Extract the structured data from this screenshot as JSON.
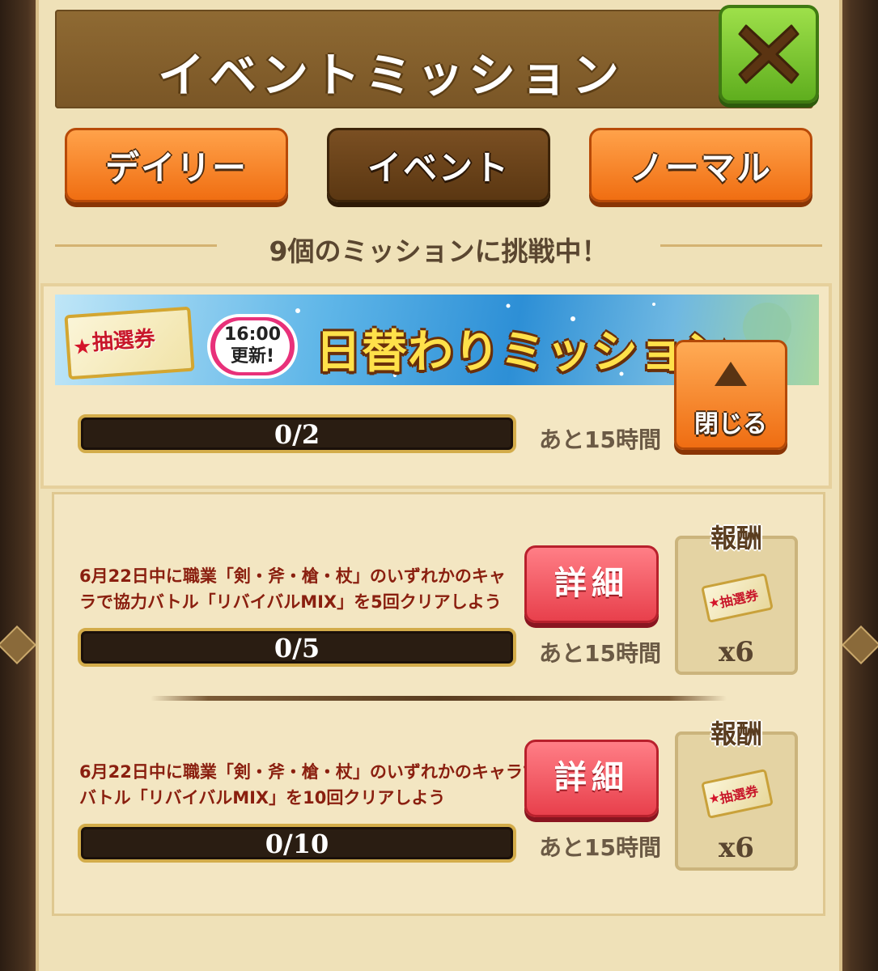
{
  "header": {
    "title": "イベントミッション",
    "close_icon": "close-icon"
  },
  "tabs": [
    {
      "label": "デイリー",
      "active": false
    },
    {
      "label": "イベント",
      "active": true
    },
    {
      "label": "ノーマル",
      "active": false
    }
  ],
  "mission_count_text": "9個のミッションに挑戦中！",
  "daily": {
    "ticket_label": "抽選券",
    "update_time": "16:00",
    "update_label": "更新!",
    "title": "日替わりミッション",
    "progress_text": "0/2",
    "progress": 0,
    "remaining": "あと15時間",
    "toggle_label": "閉じる"
  },
  "missions": [
    {
      "description_line1": "6月22日中に職業「剣・斧・槍・杖」のいずれかのキャ",
      "description_line2": "ラで協力バトル「リバイバルMIX」を5回クリアしよう",
      "detail_label": "詳細",
      "progress_text": "0/5",
      "progress": 0,
      "remaining": "あと15時間",
      "reward_label": "報酬",
      "reward_item": "抽選券",
      "reward_qty": "x6"
    },
    {
      "description_line1": "6月22日中に職業「剣・斧・槍・杖」のいずれかのキャラで協力",
      "description_line2": "バトル「リバイバルMIX」を10回クリアしよう",
      "detail_label": "詳細",
      "progress_text": "0/10",
      "progress": 0,
      "remaining": "あと15時間",
      "reward_label": "報酬",
      "reward_item": "抽選券",
      "reward_qty": "x6"
    }
  ]
}
